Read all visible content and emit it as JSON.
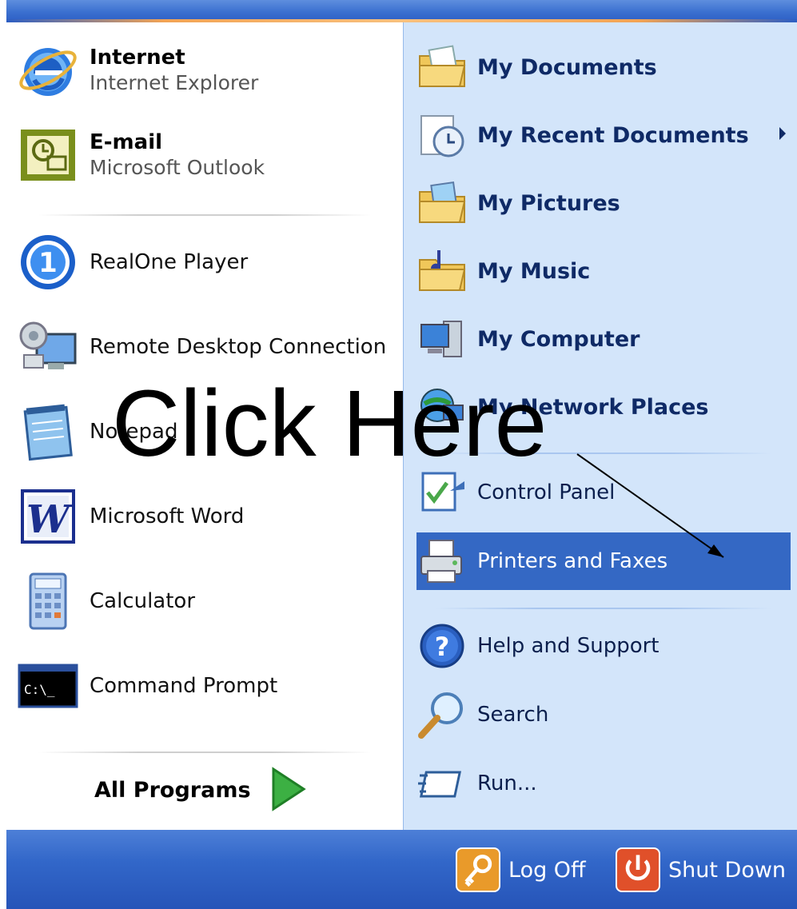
{
  "left_pinned": [
    {
      "title": "Internet",
      "subtitle": "Internet Explorer",
      "icon": "internet-explorer-icon"
    },
    {
      "title": "E-mail",
      "subtitle": "Microsoft Outlook",
      "icon": "outlook-icon"
    }
  ],
  "left_recent": [
    {
      "label": "RealOne Player",
      "icon": "realone-player-icon"
    },
    {
      "label": "Remote Desktop Connection",
      "icon": "remote-desktop-icon"
    },
    {
      "label": "Notepad",
      "icon": "notepad-icon"
    },
    {
      "label": "Microsoft Word",
      "icon": "word-icon"
    },
    {
      "label": "Calculator",
      "icon": "calculator-icon"
    },
    {
      "label": "Command Prompt",
      "icon": "command-prompt-icon"
    }
  ],
  "all_programs": {
    "label": "All Programs",
    "icon": "green-arrow-icon"
  },
  "right_places": [
    {
      "label": "My Documents",
      "icon": "my-documents-icon"
    },
    {
      "label": "My Recent Documents",
      "icon": "recent-documents-icon",
      "has_submenu": true
    },
    {
      "label": "My Pictures",
      "icon": "my-pictures-icon"
    },
    {
      "label": "My Music",
      "icon": "my-music-icon"
    },
    {
      "label": "My Computer",
      "icon": "my-computer-icon"
    },
    {
      "label": "My Network Places",
      "icon": "network-places-icon"
    }
  ],
  "right_settings": [
    {
      "label": "Control Panel",
      "icon": "control-panel-icon"
    },
    {
      "label": "Printers and Faxes",
      "icon": "printer-icon",
      "selected": true
    }
  ],
  "right_help": [
    {
      "label": "Help and Support",
      "icon": "help-icon"
    },
    {
      "label": "Search",
      "icon": "search-icon"
    },
    {
      "label": "Run...",
      "icon": "run-icon"
    }
  ],
  "bottom": {
    "log_off": {
      "label": "Log Off",
      "icon": "key-icon"
    },
    "shut_down": {
      "label": "Shut Down",
      "icon": "power-icon"
    }
  },
  "annotation": {
    "text": "Click Here"
  },
  "colors": {
    "selected_bg": "#3468c4",
    "right_panel_bg": "#d3e5fa",
    "taskbar_blue": "#2c5ec4"
  }
}
